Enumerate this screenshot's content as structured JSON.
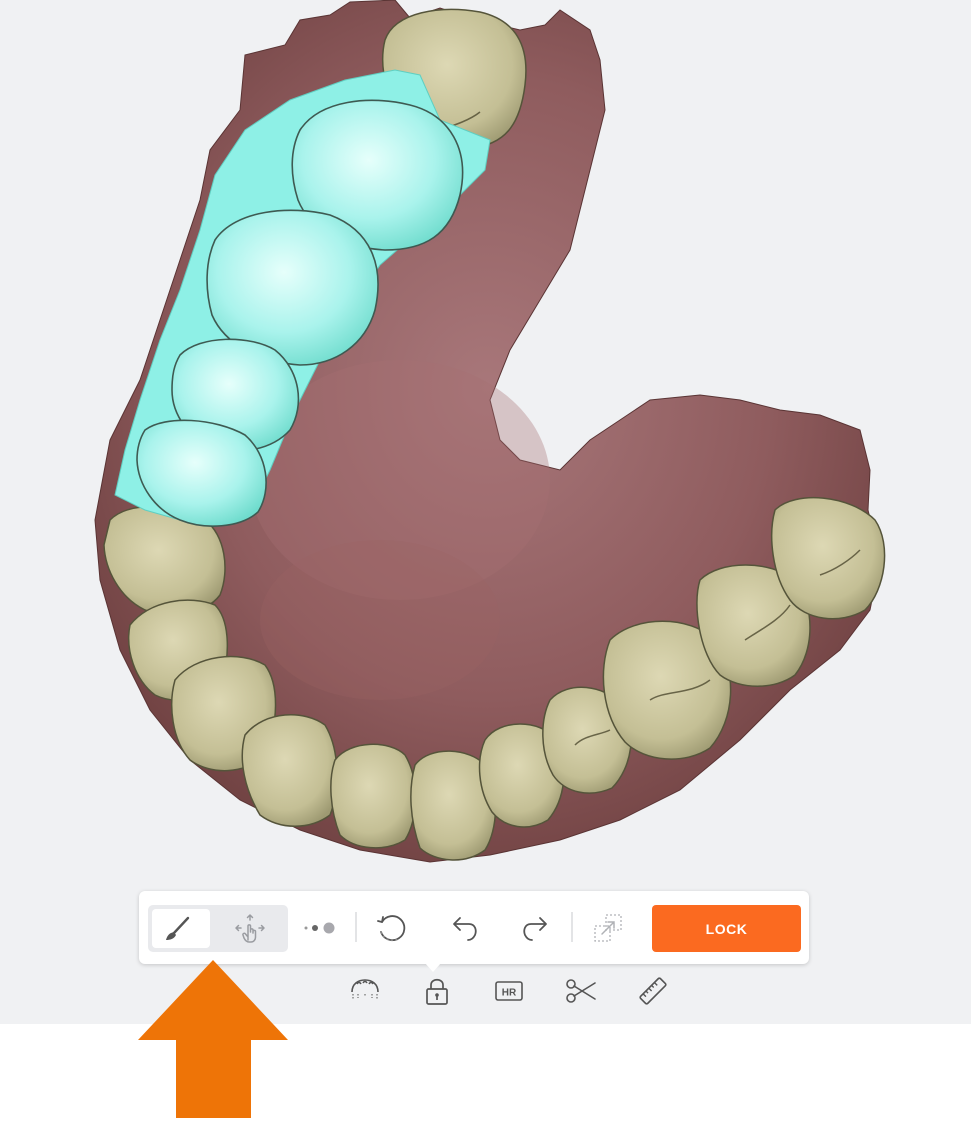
{
  "toolbar": {
    "tools": [
      {
        "id": "brush",
        "icon": "paint-brush-icon",
        "active": true
      },
      {
        "id": "move",
        "icon": "move-cursor-icon",
        "active": false
      }
    ],
    "brush_size_icon": "brush-size-dots-icon",
    "reset_icon": "reset-rotate-icon",
    "undo_icon": "undo-arrow-icon",
    "redo_icon": "redo-arrow-icon",
    "transfer_icon": "copy-transfer-icon",
    "lock_label": "LOCK"
  },
  "subbar": {
    "items": [
      {
        "icon": "jaw-arch-icon"
      },
      {
        "icon": "lock-icon",
        "active": true
      },
      {
        "icon": "hr-icon",
        "text": "HR"
      },
      {
        "icon": "scissors-icon"
      },
      {
        "icon": "ruler-icon"
      }
    ]
  },
  "colors": {
    "accent": "#fb6a20",
    "highlight_arrow": "#ee7407",
    "selection": "#8ff2ea",
    "gum": "#8b5556",
    "tooth": "#c9c49a",
    "background": "#f0f1f3"
  }
}
